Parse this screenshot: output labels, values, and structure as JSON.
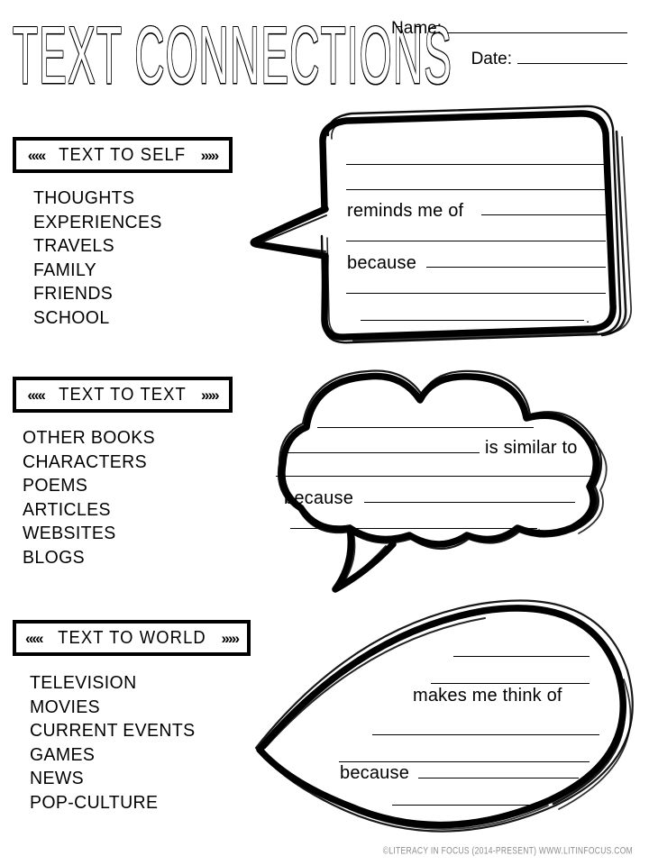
{
  "header": {
    "title": "TEXT CONNECTIONS",
    "name_label": "Name:",
    "name_value": "",
    "date_label": "Date:",
    "date_value": ""
  },
  "icons": {
    "chevron_left_triple": "«‹",
    "chevron_right_triple": "›»"
  },
  "sections": [
    {
      "id": "text-to-self",
      "heading": "TEXT TO SELF",
      "chev_left": "««‹",
      "chev_right": "›»»",
      "items": [
        "THOUGHTS",
        "EXPERIENCES",
        "TRAVELS",
        "FAMILY",
        "FRIENDS",
        "SCHOOL"
      ],
      "bubble": {
        "shape": "speech-rectangle",
        "prompt_1": "reminds me of",
        "prompt_2": "because",
        "line_count": 6,
        "end_period": "."
      }
    },
    {
      "id": "text-to-text",
      "heading": "TEXT TO TEXT",
      "chev_left": "««‹",
      "chev_right": "›»»",
      "items": [
        "OTHER BOOKS",
        "CHARACTERS",
        "POEMS",
        "ARTICLES",
        "WEBSITES",
        "BLOGS"
      ],
      "bubble": {
        "shape": "cloud",
        "prompt_1": "is similar to",
        "prompt_2": "because",
        "line_count": 5,
        "end_period": "."
      }
    },
    {
      "id": "text-to-world",
      "heading": "TEXT TO WORLD",
      "chev_left": "««‹",
      "chev_right": "›»»",
      "items": [
        "TELEVISION",
        "MOVIES",
        "CURRENT EVENTS",
        "GAMES",
        "NEWS",
        "POP-CULTURE"
      ],
      "bubble": {
        "shape": "leaf",
        "prompt_1": "makes me think of",
        "prompt_2": "because",
        "line_count": 6,
        "end_period": "."
      }
    }
  ],
  "footer": {
    "credit": "©LITERACY IN FOCUS (2014-PRESENT) WWW.LITINFOCUS.COM"
  },
  "colors": {
    "ink": "#000000",
    "paper": "#ffffff",
    "footer_gray": "#8f8f8f"
  }
}
